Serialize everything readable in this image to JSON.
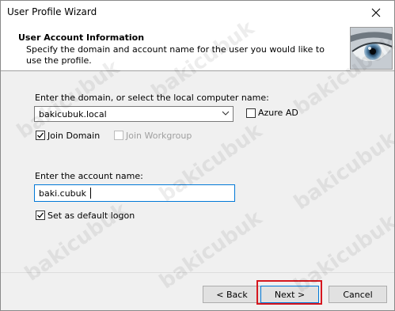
{
  "window": {
    "title": "User Profile Wizard"
  },
  "header": {
    "title": "User Account  Information",
    "description": "Specify the domain and account name for the user you would like to use the profile."
  },
  "domain_section": {
    "label": "Enter the domain, or select the local computer name:",
    "value": "bakicubuk.local",
    "azure_ad": {
      "label": "Azure AD",
      "checked": false
    },
    "join_domain": {
      "label": "Join Domain",
      "checked": true
    },
    "join_workgroup": {
      "label": "Join Workgroup",
      "checked": false,
      "disabled": true
    }
  },
  "account_section": {
    "label": "Enter the account name:",
    "value": "baki.cubuk",
    "default_logon": {
      "label": "Set as default logon",
      "checked": true
    }
  },
  "buttons": {
    "back": "< Back",
    "next": "Next >",
    "cancel": "Cancel"
  },
  "watermark": "bakicubuk",
  "colors": {
    "accent": "#0078d7",
    "highlight": "#d6171f"
  }
}
